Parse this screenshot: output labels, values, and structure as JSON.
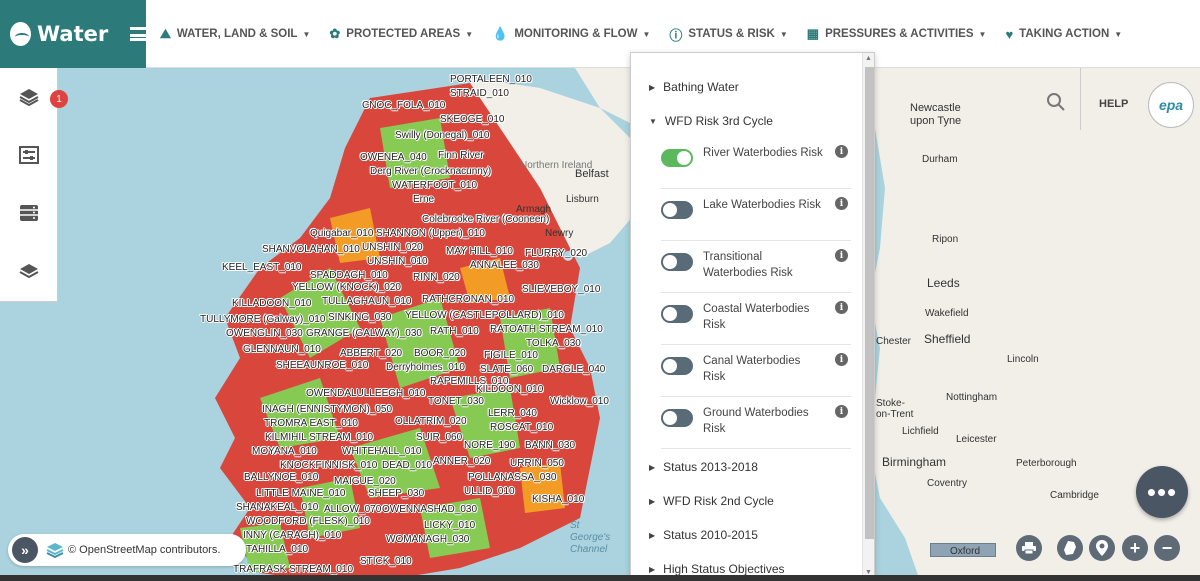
{
  "app": {
    "title": "Water"
  },
  "nav": [
    {
      "label": "WATER, LAND & SOIL",
      "icon": "landscape-icon"
    },
    {
      "label": "PROTECTED AREAS",
      "icon": "protected-areas-icon"
    },
    {
      "label": "MONITORING & FLOW",
      "icon": "water-drop-icon"
    },
    {
      "label": "STATUS & RISK",
      "icon": "info-icon"
    },
    {
      "label": "PRESSURES & ACTIVITIES",
      "icon": "factory-icon"
    },
    {
      "label": "TAKING ACTION",
      "icon": "heart-icon"
    }
  ],
  "left_tools": {
    "layers_badge": "1",
    "icons": [
      "layers-icon",
      "sliders-icon",
      "database-icon",
      "map-stack-icon"
    ]
  },
  "header_right": {
    "help": "HELP",
    "logo": "epa"
  },
  "panel": {
    "sections_top": [
      {
        "label": "Bathing Water",
        "expanded": false
      },
      {
        "label": "WFD Risk 3rd Cycle",
        "expanded": true
      }
    ],
    "layers": [
      {
        "label": "River Waterbodies Risk",
        "on": true
      },
      {
        "label": "Lake Waterbodies Risk",
        "on": false
      },
      {
        "label": "Transitional Waterbodies Risk",
        "on": false
      },
      {
        "label": "Coastal Waterbodies Risk",
        "on": false
      },
      {
        "label": "Canal Waterbodies Risk",
        "on": false
      },
      {
        "label": "Ground Waterbodies Risk",
        "on": false
      }
    ],
    "sections_bottom": [
      {
        "label": "Status 2013-2018"
      },
      {
        "label": "WFD Risk 2nd Cycle"
      },
      {
        "label": "Status 2010-2015"
      },
      {
        "label": "High Status Objectives"
      }
    ]
  },
  "map_labels": [
    "PORTALEEN_010",
    "STRAID_010",
    "CNOC_FOLA_010",
    "SKEOGE_010",
    "Swilly (Donegal)_010",
    "OWENEA_040",
    "Finn River",
    "Derg River (Crocknacunny)",
    "WATERFOOT_010",
    "Erne",
    "Colebrooke River (Cooneen)",
    "Quigabar_010",
    "SHANNON (Upper)_010",
    "SHANVOLAHAN_010",
    "UNSHIN_020",
    "MAY HILL_010",
    "FLURRY_020",
    "KEEL_EAST_010",
    "UNSHIN_010",
    "ANNALEE_030",
    "SPADDAGH_010",
    "RINN_020",
    "YELLOW (KNOCK)_020",
    "SLIEVEBOY_010",
    "KILLADOON_010",
    "TULLAGHAUN_010",
    "RATHCRONAN_010",
    "TULLYMORE (Galway)_010",
    "SINKING_030",
    "YELLOW (CASTLEPOLLARD)_010",
    "OWENGLIN_030",
    "GRANGE (GALWAY)_030",
    "RATH_010",
    "RATOATH STREAM_010",
    "TOLKA_030",
    "GLENNAUN_010",
    "ABBERT_020",
    "BOOR_020",
    "FIGILE_010",
    "SHEEAUNROE_010",
    "Derryholmes_010",
    "SLATE_060",
    "DARGLE_040",
    "RAPEMILLS_010",
    "KILDOON_010",
    "OWENDALULLEEGH_010",
    "TONET_030",
    "Wicklow_010",
    "INAGH (ENNISTYMON)_050",
    "LERR_040",
    "TROMRA EAST_010",
    "OLLATRIM_020",
    "ROSCAT_010",
    "KILMIHIL STREAM_010",
    "SUIR_060",
    "NORE_190",
    "BANN_030",
    "MOYANA_010",
    "WHITEHALL_010",
    "URRIN_050",
    "KNOCKFINNISK_010",
    "DEAD_010",
    "ANNER_020",
    "POLLANASSA_030",
    "BALLYNOE_010",
    "MAIGUE_020",
    "ULLID_010",
    "LITTLE MAINE_010",
    "SHEEP_030",
    "KISHA_010",
    "SHANAKEAL_010",
    "ALLOW_070",
    "OWENNASHAD_030",
    "WOODFORD (FLESK)_010",
    "LICKY_010",
    "INNY (CARAGH)_010",
    "WOMANAGH_030",
    "TAHILLA_010",
    "STICK_010",
    "TRAFRASK STREAM_010"
  ],
  "map_places": [
    "Northern Ireland",
    "Belfast",
    "Lisburn",
    "Armagh",
    "Newry",
    "Newcastle upon Tyne",
    "Durham",
    "Ripon",
    "Leeds",
    "Wakefield",
    "Sheffield",
    "Lincoln",
    "Nottingham",
    "Leicester",
    "Lichfield",
    "Peterborough",
    "Birmingham",
    "Coventry",
    "Cambridge",
    "Chester",
    "Stoke-on-Trent",
    "Oxford",
    "St George's Channel"
  ],
  "attribution": "© OpenStreetMap contributors.",
  "colors": {
    "brand": "#2d7a7b",
    "toggle_on": "#5cb85c",
    "toggle_off": "#5a6b78",
    "risk_red": "#e8342a",
    "risk_green": "#7ed957",
    "risk_orange": "#f5a623"
  }
}
